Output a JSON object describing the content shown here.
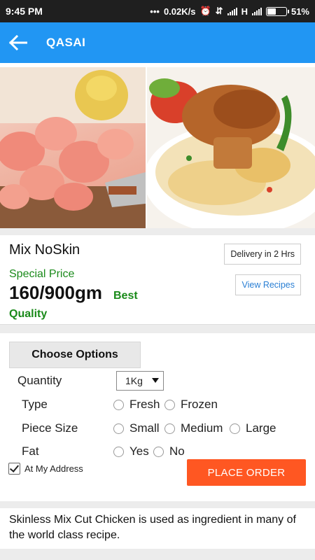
{
  "status": {
    "time": "9:45 PM",
    "speed": "0.02K/s",
    "network": "H",
    "battery": "51%",
    "battery_level": 0.51
  },
  "appbar": {
    "title": "QASAI",
    "back_icon": "arrow-left-icon"
  },
  "product": {
    "name": "Mix NoSkin",
    "special_label": "Special Price",
    "price": "160/900gm",
    "best": "Best",
    "quality": "Quality",
    "delivery": "Delivery in 2 Hrs",
    "view_recipes": "View Recipes"
  },
  "options": {
    "choose_label": "Choose Options",
    "quantity_label": "Quantity",
    "quantity_value": "1Kg",
    "type_label": "Type",
    "type_options": [
      "Fresh",
      "Frozen"
    ],
    "piece_label": "Piece Size",
    "piece_options": [
      "Small",
      "Medium",
      "Large"
    ],
    "fat_label": "Fat",
    "fat_options": [
      "Yes",
      "No"
    ],
    "address_label": "At My Address",
    "address_checked": true,
    "order_label": "PLACE ORDER"
  },
  "description": "Skinless Mix Cut Chicken is used as ingredient in many of the world class recipe.",
  "colors": {
    "appbar": "#2196f3",
    "accent_green": "#1a8a1a",
    "order_button": "#ff5722",
    "link_blue": "#2a7fd4"
  }
}
